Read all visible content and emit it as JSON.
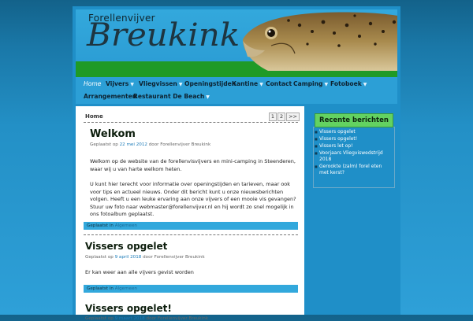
{
  "header": {
    "brand_small": "Forellenvijver",
    "brand_big": "Breukink"
  },
  "nav": {
    "row1": [
      {
        "label": "Home",
        "arrow": false
      },
      {
        "label": "Vijvers",
        "arrow": true
      },
      {
        "label": "Vliegvissen",
        "arrow": true
      },
      {
        "label": "Openingstijden",
        "arrow": false
      },
      {
        "label": "Kantine",
        "arrow": true
      },
      {
        "label": "Contact",
        "arrow": false
      },
      {
        "label": "Camping",
        "arrow": true
      },
      {
        "label": "Fotoboek",
        "arrow": true
      }
    ],
    "row2": [
      {
        "label": "Arrangementen",
        "arrow": false
      },
      {
        "label": "Restaurant De Beach",
        "arrow": true
      }
    ],
    "arrow_glyph": "▼"
  },
  "breadcrumb": "Home",
  "pager": [
    "1",
    "2",
    ">>"
  ],
  "posts": [
    {
      "title": "Welkom",
      "meta_prefix": "Geplaatst op",
      "date": "22 mei 2012",
      "meta_by": "door",
      "author": "Forellenvijver Breukink",
      "paragraphs": [
        "Welkom op de website van de forellenvisvijvers en mini-camping in Steenderen, waar wij u van harte welkom heten.",
        "U kunt hier terecht voor informatie over openingstijden en tarieven, maar ook voor tips en actueel nieuws. Onder dit bericht kunt u onze nieuwsberichten volgen. Heeft u een leuke ervaring aan onze vijvers of een mooie vis gevangen? Stuur uw foto naar webmaster@forellenvijver.nl en hij wordt zo snel mogelijk in ons fotoalbum geplaatst."
      ],
      "cat_prefix": "Geplaatst in",
      "category": "Algemeen"
    },
    {
      "title": "Vissers opgelet",
      "meta_prefix": "Geplaatst op",
      "date": "9 april 2018",
      "meta_by": "door",
      "author": "Forellenvijver Breukink",
      "paragraphs": [
        "Er kan weer aan alle vijvers gevist worden"
      ],
      "cat_prefix": "Geplaatst in",
      "category": "Algemeen"
    },
    {
      "title": "Vissers opgelet!",
      "meta_prefix": "Geplaatst op",
      "date": "9 maart 2018",
      "meta_by": "door",
      "author": "Forellenvijver Breukink"
    }
  ],
  "sidebar": {
    "title": "Recente berichten",
    "items": [
      "Vissers opgelet",
      "Vissers opgelet!",
      "Vissers let op!",
      "Voorjaars Vliegviswedstrijd 2018",
      "Gerookte (zalm) forel eten met kerst?"
    ]
  },
  "colors": {
    "nav_bg": "#2c9fd6",
    "header_green": "#1f9a26",
    "widget_green": "#63d261",
    "category_bar": "#32a8dc"
  }
}
